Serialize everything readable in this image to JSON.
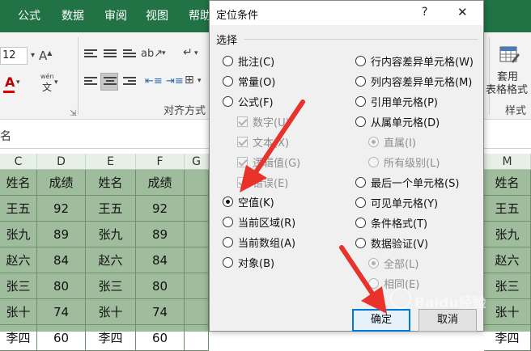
{
  "ribbon": {
    "tabs": [
      "公式",
      "数据",
      "审阅",
      "视图",
      "帮助"
    ],
    "font_size": "12",
    "group_align_label": "对齐方式",
    "table_format_line1": "套用",
    "table_format_line2": "表格格式",
    "styles_label": "样式",
    "pinyin_label": "wén"
  },
  "formula_bar": {
    "name_box": "名"
  },
  "sheet": {
    "col_letters": [
      "C",
      "D",
      "E",
      "F",
      "G",
      "M"
    ],
    "header_row": [
      "姓名",
      "成绩",
      "姓名",
      "成绩",
      "",
      "姓名"
    ],
    "rows": [
      [
        "王五",
        "92",
        "王五",
        "92",
        "",
        "王五"
      ],
      [
        "张九",
        "89",
        "张九",
        "89",
        "",
        "张九"
      ],
      [
        "赵六",
        "84",
        "赵六",
        "84",
        "",
        "赵六"
      ],
      [
        "张三",
        "80",
        "张三",
        "80",
        "",
        "张三"
      ],
      [
        "张十",
        "74",
        "张十",
        "74",
        "",
        "张十"
      ],
      [
        "李四",
        "60",
        "李四",
        "60",
        "",
        "李四"
      ]
    ]
  },
  "dialog": {
    "title": "定位条件",
    "help_label": "?",
    "close_label": "✕",
    "section_label": "选择",
    "left_options": [
      {
        "label": "批注(C)",
        "checked": false,
        "disabled": false
      },
      {
        "label": "常量(O)",
        "checked": false,
        "disabled": false
      },
      {
        "label": "公式(F)",
        "checked": false,
        "disabled": false
      },
      {
        "label": "空值(K)",
        "checked": true,
        "disabled": false
      },
      {
        "label": "当前区域(R)",
        "checked": false,
        "disabled": false
      },
      {
        "label": "当前数组(A)",
        "checked": false,
        "disabled": false
      },
      {
        "label": "对象(B)",
        "checked": false,
        "disabled": false
      }
    ],
    "formula_subs": [
      "数字(U)",
      "文本(X)",
      "逻辑值(G)",
      "错误(E)"
    ],
    "right_options": [
      {
        "label": "行内容差异单元格(W)",
        "checked": false,
        "disabled": false
      },
      {
        "label": "列内容差异单元格(M)",
        "checked": false,
        "disabled": false
      },
      {
        "label": "引用单元格(P)",
        "checked": false,
        "disabled": false
      },
      {
        "label": "从属单元格(D)",
        "checked": false,
        "disabled": false
      },
      {
        "label": "直属(I)",
        "checked": true,
        "disabled": true
      },
      {
        "label": "所有级别(L)",
        "checked": false,
        "disabled": true
      },
      {
        "label": "最后一个单元格(S)",
        "checked": false,
        "disabled": false
      },
      {
        "label": "可见单元格(Y)",
        "checked": false,
        "disabled": false
      },
      {
        "label": "条件格式(T)",
        "checked": false,
        "disabled": false
      },
      {
        "label": "数据验证(V)",
        "checked": false,
        "disabled": false
      },
      {
        "label": "全部(L)",
        "checked": true,
        "disabled": true
      },
      {
        "label": "相同(E)",
        "checked": false,
        "disabled": true
      }
    ],
    "ok_label": "确定",
    "cancel_label": "取消"
  },
  "colors": {
    "excel_green": "#217346",
    "grid_fill": "#9fbc9c",
    "arrow_red": "#e8322a",
    "focus_blue": "#0078d7"
  },
  "watermark": "Baidu经验"
}
